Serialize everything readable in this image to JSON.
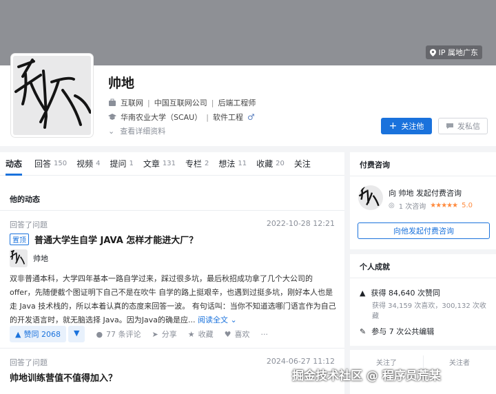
{
  "header": {
    "ip_label": "IP 属地广东"
  },
  "profile": {
    "name": "帅地",
    "row1": [
      "互联网",
      "中国互联网公司",
      "后端工程师"
    ],
    "row2": [
      "华南农业大学（SCAU）",
      "软件工程"
    ],
    "more_label": "查看详细资料",
    "follow_label": "关注他",
    "message_label": "发私信",
    "accent": "#1a72dc"
  },
  "tabs": [
    {
      "label": "动态",
      "count": ""
    },
    {
      "label": "回答",
      "count": "150"
    },
    {
      "label": "视频",
      "count": "4"
    },
    {
      "label": "提问",
      "count": "1"
    },
    {
      "label": "文章",
      "count": "131"
    },
    {
      "label": "专栏",
      "count": "2"
    },
    {
      "label": "想法",
      "count": "11"
    },
    {
      "label": "收藏",
      "count": "20"
    },
    {
      "label": "关注",
      "count": ""
    }
  ],
  "feed": {
    "section_title": "他的动态",
    "item1": {
      "meta": "回答了问题",
      "date": "2022-10-28 12:21",
      "badge": "置顶",
      "title": "普通大学生自学 JAVA 怎样才能进大厂？",
      "author": "帅地",
      "excerpt": "双非普通本科，大学四年基本一路自学过来，踩过很多坑，最后秋招成功拿了几个大公司的 offer，先随便截个图证明下自己不是在吹牛 自学的路上挺艰辛，也遇到过挺多坑，刚好本人也是走 Java 技术栈的，所以本着认真的态度来回答一波。 有句话叫：当你不知道选哪门语言作为自己的开发语言时，就无脑选择 Java。因为Java的确是应...",
      "read_more": "阅读全文",
      "vote_label": "赞同 2068",
      "comments": "77 条评论",
      "share": "分享",
      "favorite": "收藏",
      "like": "喜欢",
      "more": "···"
    },
    "item2": {
      "meta": "回答了问题",
      "date": "2024-06-27 11:12",
      "title": "帅地训练营值不值得加入？"
    }
  },
  "sidebar": {
    "consult": {
      "title": "付费咨询",
      "line1": "向 帅地 发起付费咨询",
      "count": "1 次咨询",
      "rating": "5.0",
      "button": "向他发起付费咨询"
    },
    "achievements": {
      "title": "个人成就",
      "likes": "获得 84,640 次赞同",
      "likes_sub": "获得 34,159 次喜欢，300,132 次收藏",
      "edit": "参与 7 次公共编辑"
    },
    "follow": {
      "following_label": "关注了",
      "followers_label": "关注者"
    }
  },
  "watermark": "掘金技术社区 @ 程序员荒某"
}
